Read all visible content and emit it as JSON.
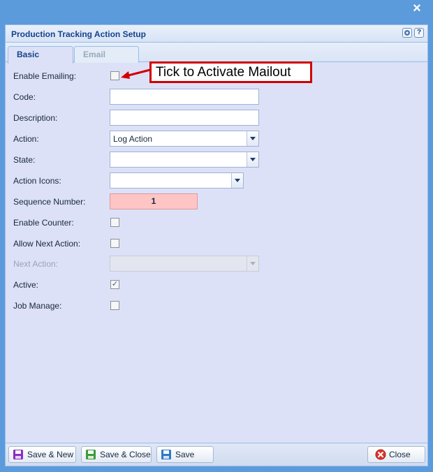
{
  "window": {
    "close_glyph": "×",
    "title": "Production Tracking Action Setup",
    "help_glyph": "?"
  },
  "tabs": [
    {
      "label": "Basic",
      "active": true
    },
    {
      "label": "Email",
      "active": false
    }
  ],
  "form": {
    "enable_emailing": {
      "label": "Enable Emailing:",
      "checked": false
    },
    "code": {
      "label": "Code:",
      "value": ""
    },
    "description": {
      "label": "Description:",
      "value": ""
    },
    "action": {
      "label": "Action:",
      "value": "Log Action"
    },
    "state": {
      "label": "State:",
      "value": ""
    },
    "action_icons": {
      "label": "Action Icons:",
      "value": ""
    },
    "sequence_number": {
      "label": "Sequence Number:",
      "value": "1"
    },
    "enable_counter": {
      "label": "Enable Counter:",
      "checked": false
    },
    "allow_next_action": {
      "label": "Allow Next Action:",
      "checked": false
    },
    "next_action": {
      "label": "Next Action:",
      "value": "",
      "disabled": true
    },
    "active": {
      "label": "Active:",
      "checked": true,
      "check_glyph": "✓"
    },
    "job_manage": {
      "label": "Job Manage:",
      "checked": false
    }
  },
  "callout": {
    "text": "Tick to Activate Mailout"
  },
  "buttons": {
    "save_new": "Save & New",
    "save_close": "Save & Close",
    "save": "Save",
    "close": "Close"
  },
  "colors": {
    "window_bg": "#5b9bdc",
    "panel_bg": "#dde1f7",
    "title_text": "#15428b",
    "callout_border": "#d00000",
    "sequence_bg": "#ffc5c5"
  }
}
